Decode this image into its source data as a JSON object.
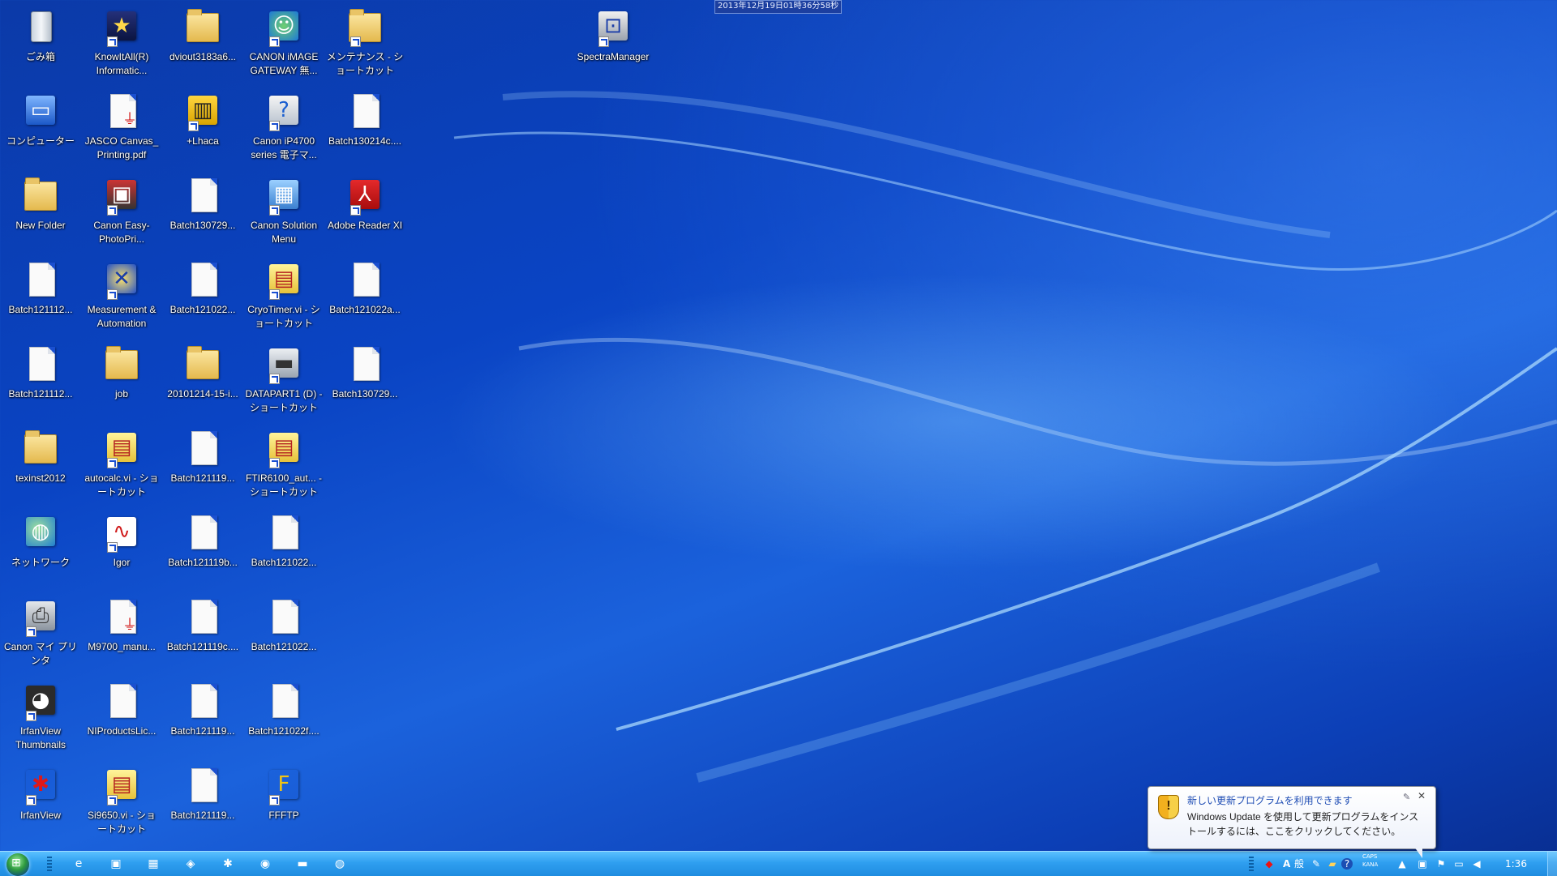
{
  "overlay_datetime": "2013年12月19日01時36分58秒",
  "desktop": {
    "icons": [
      {
        "label": "ごみ箱",
        "icon": "recycle-bin-icon"
      },
      {
        "label": "コンピューター",
        "icon": "computer-icon"
      },
      {
        "label": "New Folder",
        "icon": "folder-icon"
      },
      {
        "label": "Batch121112...",
        "icon": "file-icon"
      },
      {
        "label": "Batch121112...",
        "icon": "file-icon"
      },
      {
        "label": "texinst2012",
        "icon": "folder-icon"
      },
      {
        "label": "ネットワーク",
        "icon": "network-icon"
      },
      {
        "label": "Canon マイ プリンタ",
        "icon": "printer-icon"
      },
      {
        "label": "IrfanView Thumbnails",
        "icon": "irfanview-thumbnails-icon"
      },
      {
        "label": "IrfanView",
        "icon": "irfanview-icon"
      },
      {
        "label": "KnowItAll(R) Informatic...",
        "icon": "knowitall-icon"
      },
      {
        "label": "JASCO Canvas_ Printing.pdf",
        "icon": "pdf-file-icon"
      },
      {
        "label": "Canon Easy-PhotoPri...",
        "icon": "canon-photoprint-icon"
      },
      {
        "label": "Measurement & Automation",
        "icon": "ni-max-icon"
      },
      {
        "label": "job",
        "icon": "folder-icon"
      },
      {
        "label": "autocalc.vi - ショートカット",
        "icon": "labview-vi-icon"
      },
      {
        "label": "Igor",
        "icon": "igor-icon"
      },
      {
        "label": "M9700_manu...",
        "icon": "pdf-file-icon"
      },
      {
        "label": "NIProductsLic...",
        "icon": "file-icon"
      },
      {
        "label": "Si9650.vi - ショートカット",
        "icon": "labview-vi-icon"
      },
      {
        "label": "dviout3183a6...",
        "icon": "folder-icon"
      },
      {
        "label": "+Lhaca",
        "icon": "lhaca-icon"
      },
      {
        "label": "Batch130729...",
        "icon": "file-icon"
      },
      {
        "label": "Batch121022...",
        "icon": "file-icon"
      },
      {
        "label": "20101214-15-i...",
        "icon": "folder-icon"
      },
      {
        "label": "Batch121119...",
        "icon": "file-icon"
      },
      {
        "label": "Batch121119b...",
        "icon": "file-icon"
      },
      {
        "label": "Batch121119c....",
        "icon": "file-icon"
      },
      {
        "label": "Batch121119...",
        "icon": "file-icon"
      },
      {
        "label": "Batch121119...",
        "icon": "file-icon"
      },
      {
        "label": "CANON iMAGE GATEWAY 無...",
        "icon": "canon-gateway-icon"
      },
      {
        "label": "Canon iP4700 series 電子マ...",
        "icon": "canon-manual-icon"
      },
      {
        "label": "Canon Solution Menu",
        "icon": "canon-solution-menu-icon"
      },
      {
        "label": "CryoTimer.vi - ショートカット",
        "icon": "labview-vi-icon"
      },
      {
        "label": "DATAPART1 (D) - ショートカット",
        "icon": "drive-icon"
      },
      {
        "label": "FTIR6100_aut... - ショートカット",
        "icon": "labview-vi-icon"
      },
      {
        "label": "Batch121022...",
        "icon": "file-icon"
      },
      {
        "label": "Batch121022...",
        "icon": "file-icon"
      },
      {
        "label": "Batch121022f....",
        "icon": "file-icon"
      },
      {
        "label": "FFFTP",
        "icon": "ffftp-icon"
      },
      {
        "label": "メンテナンス - ショートカット",
        "icon": "folder-shortcut-icon"
      },
      {
        "label": "Batch130214c....",
        "icon": "file-icon"
      },
      {
        "label": "Adobe Reader XI",
        "icon": "adobe-reader-icon"
      },
      {
        "label": "Batch121022a...",
        "icon": "file-icon"
      },
      {
        "label": "Batch130729...",
        "icon": "file-icon"
      },
      {
        "label": "SpectraManager",
        "icon": "spectramanager-icon"
      }
    ]
  },
  "taskbar": {
    "start_label": "Start",
    "pinned": [
      {
        "icon": "internet-explorer-icon",
        "glyph": "e"
      },
      {
        "icon": "media-app-icon",
        "glyph": "▣"
      },
      {
        "icon": "calculator-icon",
        "glyph": "▦"
      },
      {
        "icon": "remote-app-icon",
        "glyph": "◈"
      },
      {
        "icon": "irfanview-icon",
        "glyph": "✱"
      },
      {
        "icon": "media-player-icon",
        "glyph": "◉"
      },
      {
        "icon": "explorer-icon",
        "glyph": "▬"
      },
      {
        "icon": "network-globe-icon",
        "glyph": "◍"
      }
    ],
    "tray": {
      "ime_mode": "A",
      "ime_kana": "般",
      "caps_label": "CAPS",
      "kana_label": "KANA",
      "time": "1:36"
    }
  },
  "notification": {
    "title": "新しい更新プログラムを利用できます",
    "body": "Windows Update を使用して更新プログラムをインストールするには、ここをクリックしてください。",
    "pin_glyph": "✎",
    "close_glyph": "✕"
  },
  "colors": {
    "desktop_blue": "#0a44c4",
    "taskbar_blue": "#2f9ff0",
    "notification_title": "#1e4cb4"
  }
}
